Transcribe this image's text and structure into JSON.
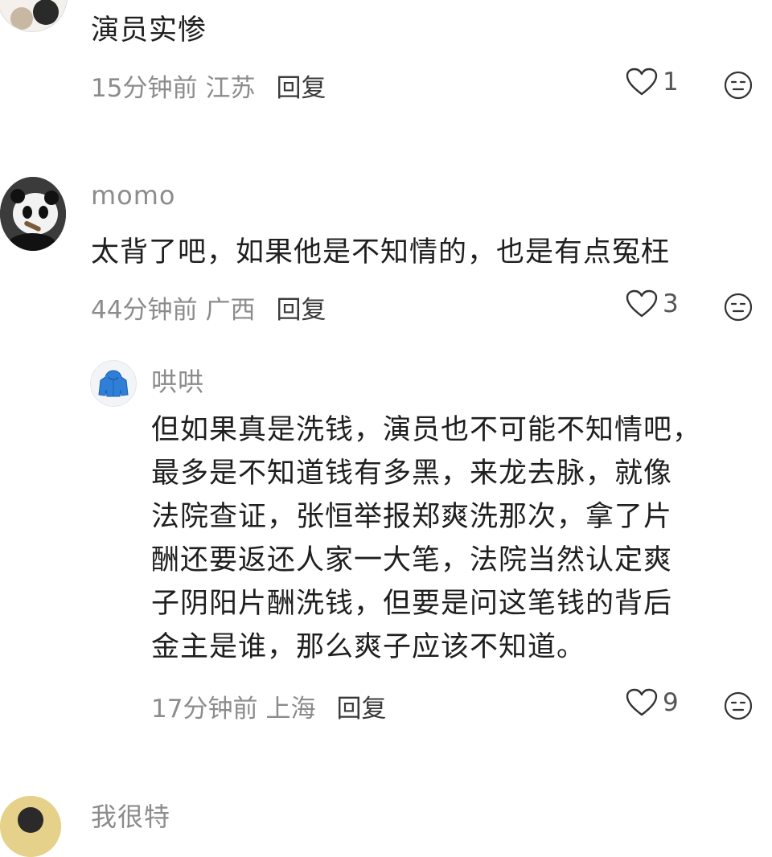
{
  "comments": [
    {
      "content": "演员实惨",
      "time": "15分钟前",
      "location": "江苏",
      "reply_label": "回复",
      "likes": "1"
    },
    {
      "username": "momo",
      "content": "太背了吧，如果他是不知情的，也是有点冤枉",
      "time": "44分钟前",
      "location": "广西",
      "reply_label": "回复",
      "likes": "3"
    },
    {
      "username": "哄哄",
      "content_lines": [
        "但如果真是洗钱，演员也不可能不知情吧，",
        "最多是不知道钱有多黑，来龙去脉，就像",
        "法院查证，张恒举报郑爽洗那次，拿了片",
        "酬还要返还人家一大笔，法院当然认定爽",
        "子阴阳片酬洗钱，但要是问这笔钱的背后",
        "金主是谁，那么爽子应该不知道。"
      ],
      "time": "17分钟前",
      "location": "上海",
      "reply_label": "回复",
      "likes": "9"
    },
    {
      "username": "我很特"
    }
  ],
  "icons": {
    "like": "heart-outline-icon",
    "more": "neutral-face-icon"
  },
  "colors": {
    "text": "#1f1f1f",
    "meta": "#8c8c8c",
    "icon": "#333333"
  }
}
